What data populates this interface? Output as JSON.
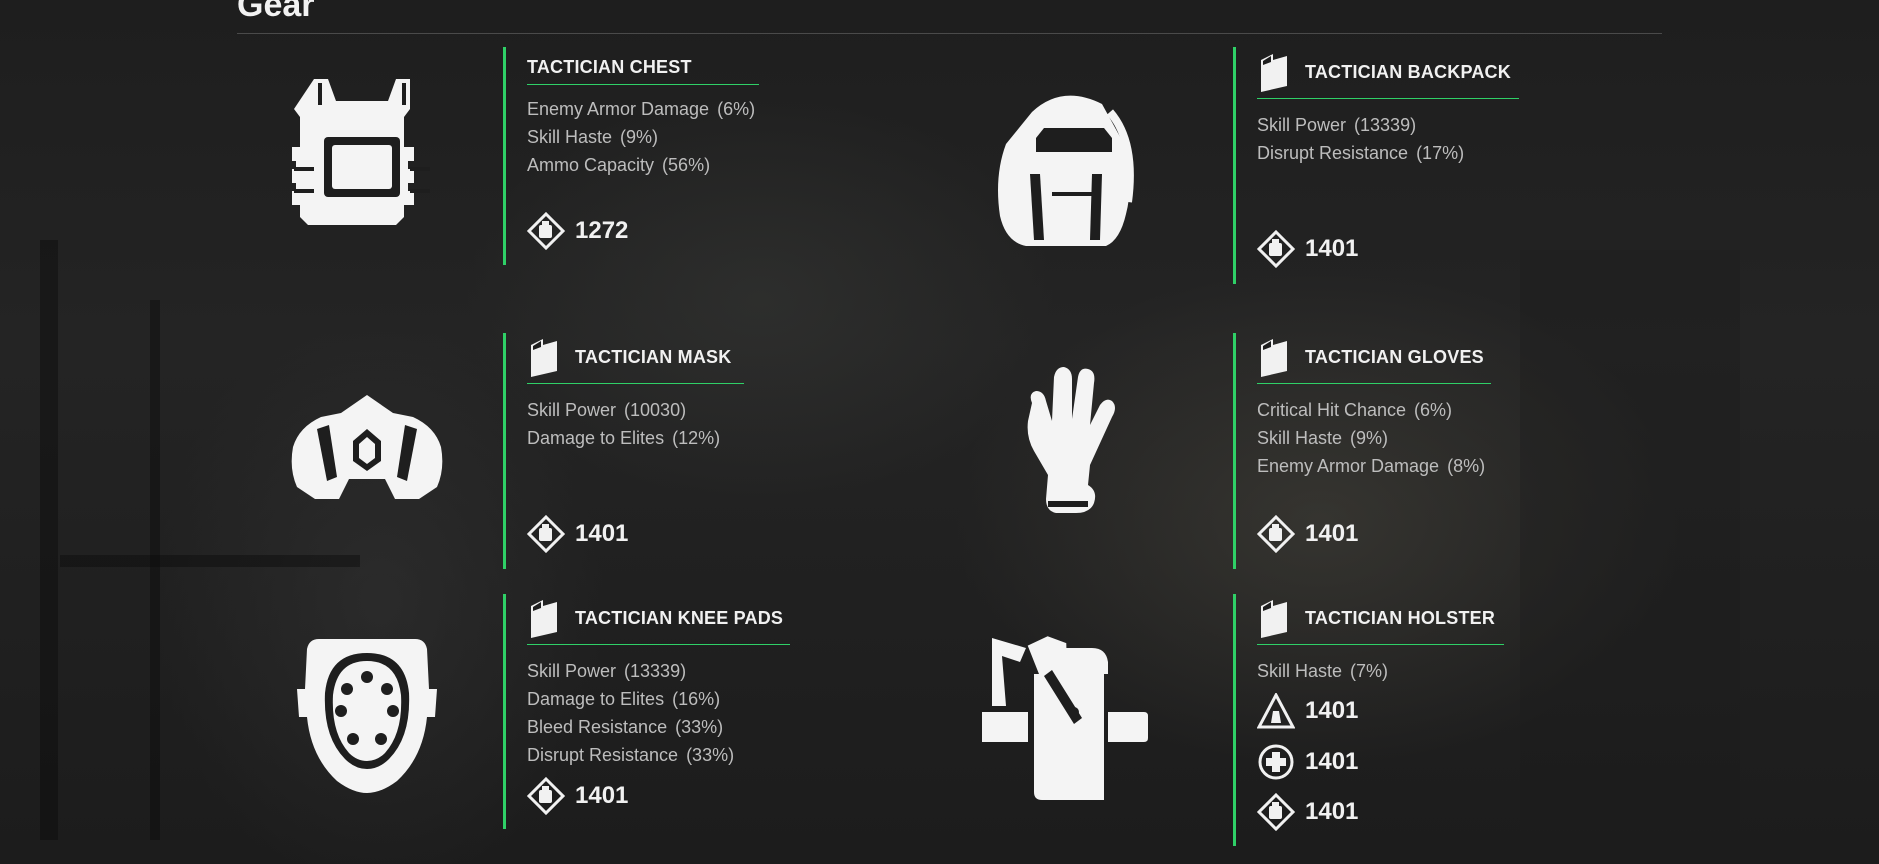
{
  "section": {
    "title": "Gear"
  },
  "items": [
    {
      "name": "TACTICIAN CHEST",
      "icon": "chest-armor-icon",
      "stats": [
        {
          "label": "Enemy Armor Damage",
          "value": "(6%)"
        },
        {
          "label": "Skill Haste",
          "value": "(9%)"
        },
        {
          "label": "Ammo Capacity",
          "value": "(56%)"
        }
      ],
      "scores": [
        {
          "icon": "armor-score-icon",
          "value": "1272"
        }
      ]
    },
    {
      "name": "TACTICIAN BACKPACK",
      "icon": "backpack-icon",
      "stats": [
        {
          "label": "Skill Power",
          "value": "(13339)"
        },
        {
          "label": "Disrupt Resistance",
          "value": "(17%)"
        }
      ],
      "scores": [
        {
          "icon": "armor-score-icon",
          "value": "1401"
        }
      ]
    },
    {
      "name": "TACTICIAN MASK",
      "icon": "mask-icon",
      "stats": [
        {
          "label": "Skill Power",
          "value": "(10030)"
        },
        {
          "label": "Damage to Elites",
          "value": "(12%)"
        }
      ],
      "scores": [
        {
          "icon": "armor-score-icon",
          "value": "1401"
        }
      ]
    },
    {
      "name": "TACTICIAN GLOVES",
      "icon": "gloves-icon",
      "stats": [
        {
          "label": "Critical Hit Chance",
          "value": "(6%)"
        },
        {
          "label": "Skill Haste",
          "value": "(9%)"
        },
        {
          "label": "Enemy Armor Damage",
          "value": "(8%)"
        }
      ],
      "scores": [
        {
          "icon": "armor-score-icon",
          "value": "1401"
        }
      ]
    },
    {
      "name": "TACTICIAN KNEE PADS",
      "icon": "knee-pads-icon",
      "stats": [
        {
          "label": "Skill Power",
          "value": "(13339)"
        },
        {
          "label": "Damage to Elites",
          "value": "(16%)"
        },
        {
          "label": "Bleed Resistance",
          "value": "(33%)"
        },
        {
          "label": "Disrupt Resistance",
          "value": "(33%)"
        }
      ],
      "scores": [
        {
          "icon": "armor-score-icon",
          "value": "1401"
        }
      ]
    },
    {
      "name": "TACTICIAN HOLSTER",
      "icon": "holster-icon",
      "stats": [
        {
          "label": "Skill Haste",
          "value": "(7%)"
        }
      ],
      "scores": [
        {
          "icon": "tech-triangle-icon",
          "value": "1401"
        },
        {
          "icon": "health-cross-icon",
          "value": "1401"
        },
        {
          "icon": "armor-score-icon",
          "value": "1401"
        }
      ]
    }
  ]
}
